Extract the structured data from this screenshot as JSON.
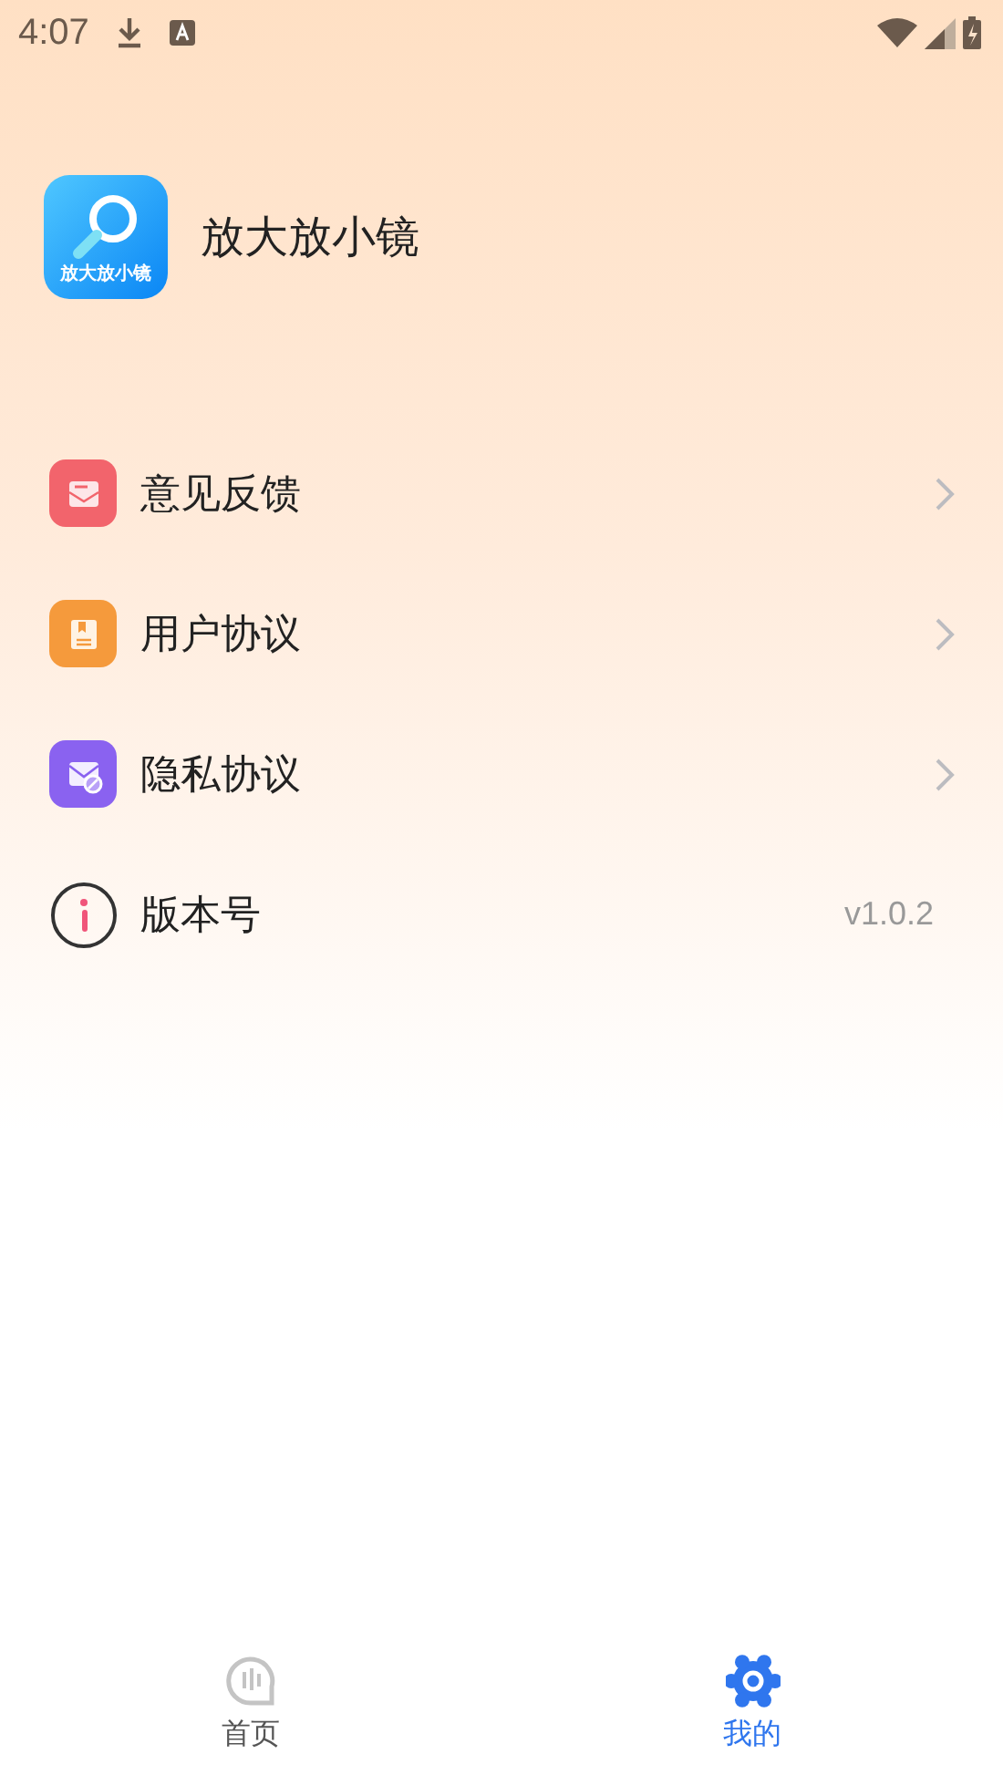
{
  "status_bar": {
    "time": "4:07"
  },
  "app": {
    "icon_label": "放大放小镜",
    "name": "放大放小镜"
  },
  "menu": [
    {
      "kind": "link",
      "label": "意见反馈",
      "color": "#f2646c"
    },
    {
      "kind": "link",
      "label": "用户协议",
      "color": "#f59a3c"
    },
    {
      "kind": "link",
      "label": "隐私协议",
      "color": "#8a62f0"
    },
    {
      "kind": "value",
      "label": "版本号",
      "value": "v1.0.2"
    }
  ],
  "tabs": [
    {
      "label": "首页",
      "selected": false
    },
    {
      "label": "我的",
      "selected": true
    }
  ]
}
